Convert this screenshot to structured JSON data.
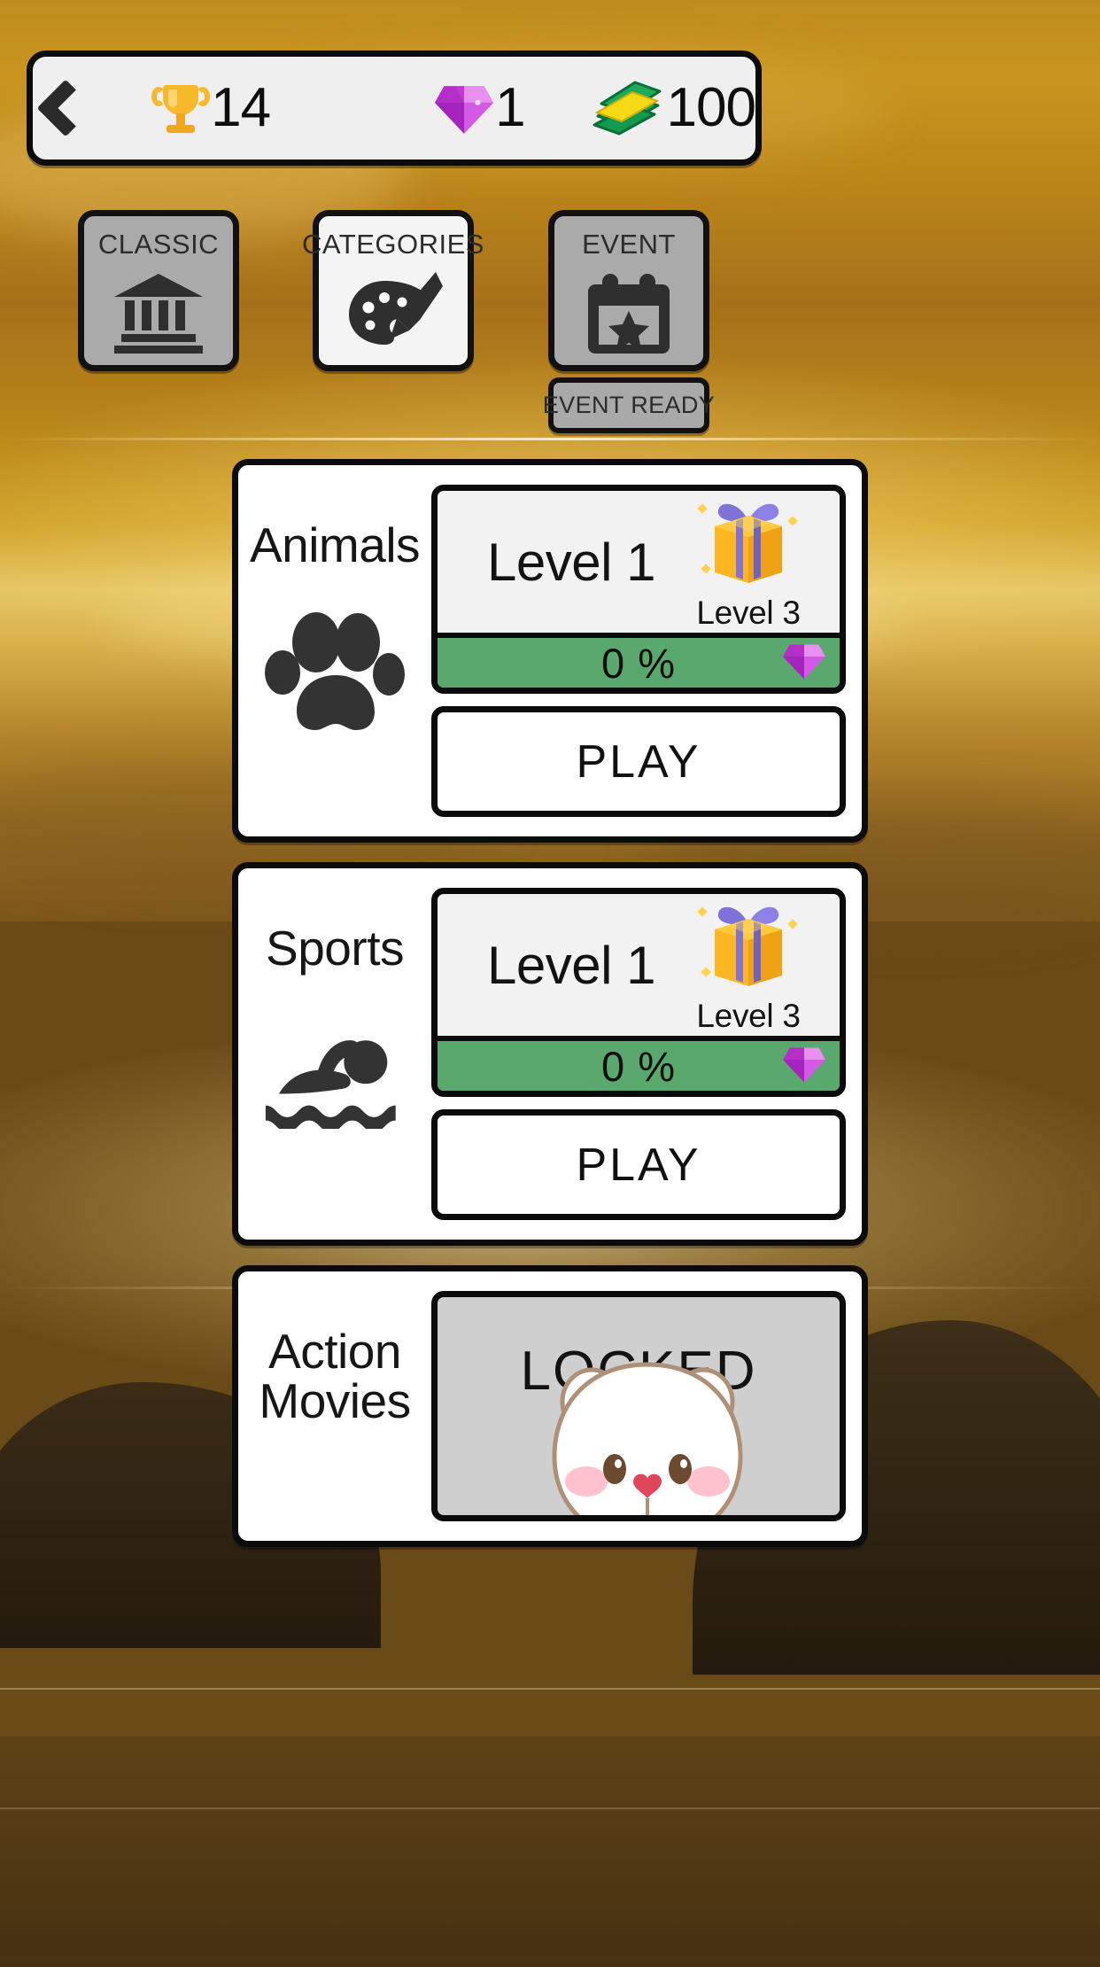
{
  "topbar": {
    "back_icon": "chevron-left-icon",
    "stats": [
      {
        "icon": "trophy-icon",
        "value": "14"
      },
      {
        "icon": "gem-icon",
        "value": "1"
      },
      {
        "icon": "cash-icon",
        "value": "100"
      }
    ]
  },
  "modes": [
    {
      "label": "CLASSIC",
      "icon": "bank-columns-icon",
      "state": "inactive"
    },
    {
      "label": "CATEGORIES",
      "icon": "palette-brush-icon",
      "state": "active"
    },
    {
      "label": "EVENT",
      "icon": "calendar-star-icon",
      "state": "inactive"
    }
  ],
  "event_badge": {
    "label": "EVENT READY"
  },
  "cards": [
    {
      "title": "Animals",
      "icon": "paw-print-icon",
      "locked": false,
      "level_label": "Level 1",
      "gift_icon": "gift-box-icon",
      "gift_level_label": "Level 3",
      "progress_label": "0 %",
      "progress_percent": 0,
      "progress_reward_icon": "gem-icon",
      "play_label": "PLAY"
    },
    {
      "title": "Sports",
      "icon": "swimmer-icon",
      "locked": false,
      "level_label": "Level 1",
      "gift_icon": "gift-box-icon",
      "gift_level_label": "Level 3",
      "progress_label": "0 %",
      "progress_percent": 0,
      "progress_reward_icon": "gem-icon",
      "play_label": "PLAY"
    },
    {
      "title": "Action Movies",
      "icon": "",
      "locked": true,
      "locked_label": "LOCKED",
      "mascot_icon": "bear-mascot-icon"
    }
  ],
  "colors": {
    "progress_green": "#59a96f",
    "gem_purple": "#cf4ae0",
    "gift_yellow": "#ffb620",
    "gift_ribbon": "#7f72d8",
    "trophy_gold": "#f7b92a",
    "cash_green": "#17a557",
    "outline": "#0b0b0b",
    "inactive_gray": "#aaaaaa",
    "locked_gray": "#cfcfcf"
  }
}
